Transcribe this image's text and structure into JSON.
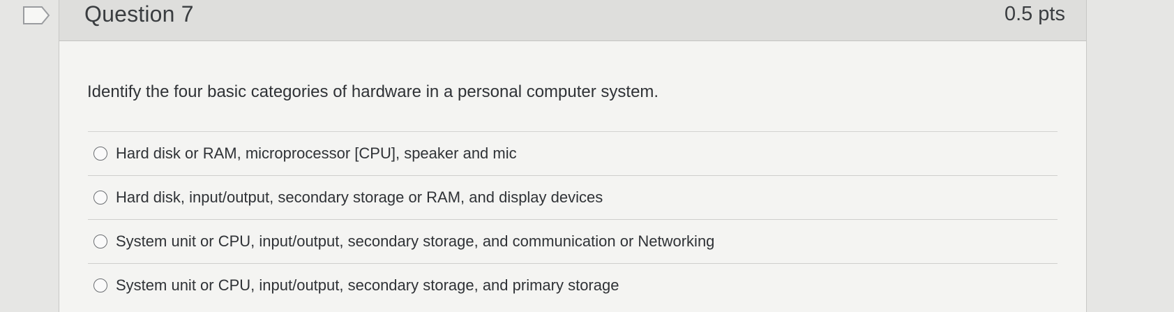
{
  "question": {
    "title": "Question 7",
    "points": "0.5 pts",
    "flag_icon": "flag-bookmark-icon",
    "text": "Identify the four basic categories of hardware in a personal computer system."
  },
  "answers": [
    {
      "label": "Hard disk or RAM, microprocessor [CPU], speaker and mic",
      "selected": false
    },
    {
      "label": "Hard disk, input/output, secondary storage or RAM, and display devices",
      "selected": false
    },
    {
      "label": "System unit or CPU, input/output, secondary storage, and communication or Networking",
      "selected": false
    },
    {
      "label": "System unit or CPU, input/output, secondary storage, and primary storage",
      "selected": false
    }
  ]
}
